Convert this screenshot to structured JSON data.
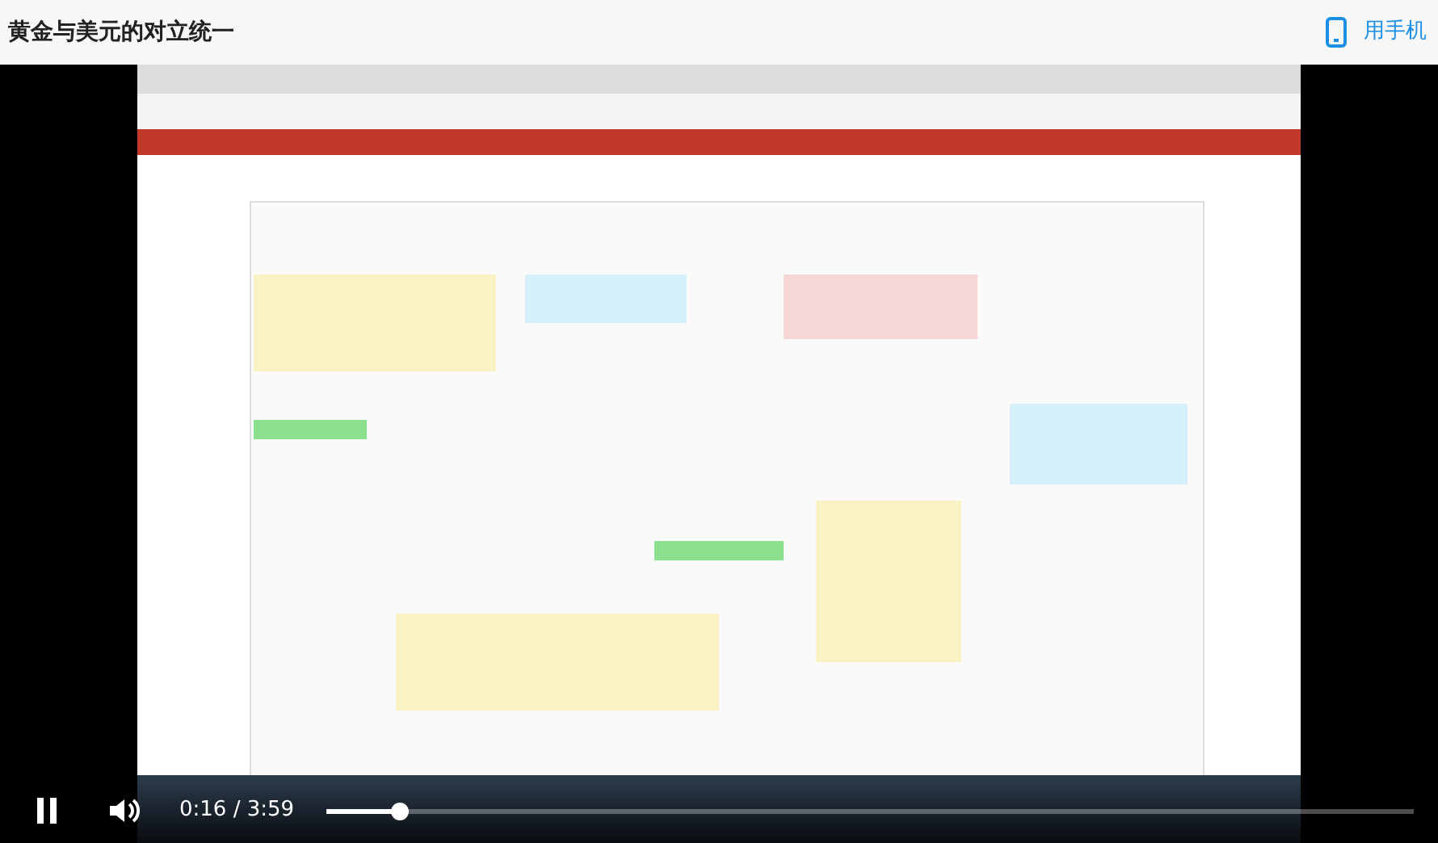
{
  "title": "黄金与美元的对立统一",
  "mobile_link": "用手机",
  "player": {
    "playing": true,
    "time": "0:16 / 3:59",
    "progress": {
      "level": 0.067
    }
  }
}
